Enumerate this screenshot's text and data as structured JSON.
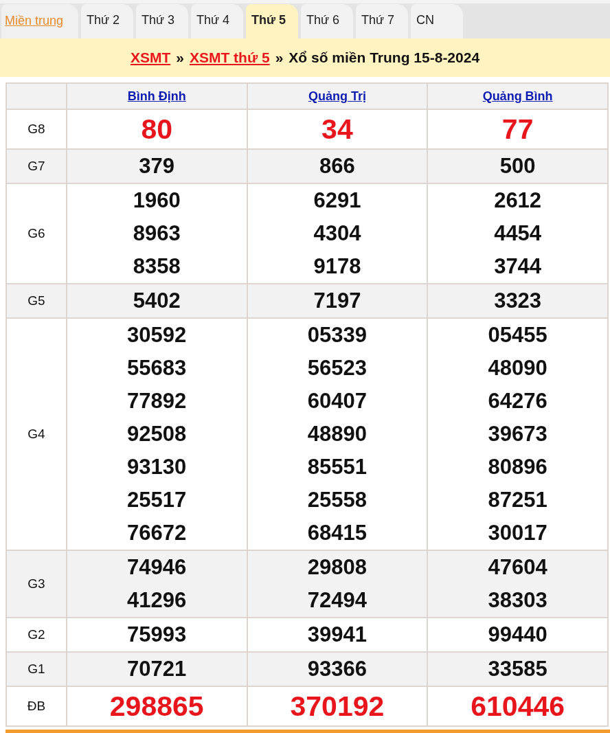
{
  "region_link": "Miền trung",
  "tabs": [
    {
      "label": "Thứ 2",
      "selected": false
    },
    {
      "label": "Thứ 3",
      "selected": false
    },
    {
      "label": "Thứ 4",
      "selected": false
    },
    {
      "label": "Thứ 5",
      "selected": true
    },
    {
      "label": "Thứ 6",
      "selected": false
    },
    {
      "label": "Thứ 7",
      "selected": false
    },
    {
      "label": "CN",
      "selected": false
    }
  ],
  "breadcrumb": {
    "links": [
      "XSMT",
      "XSMT thứ 5"
    ],
    "separator": "»",
    "title": "Xổ số miền Trung 15-8-2024"
  },
  "table": {
    "provinces": [
      "Bình Định",
      "Quảng Trị",
      "Quảng Bình"
    ],
    "prizes": [
      {
        "label": "G8",
        "kind": "highlight",
        "numbers": [
          [
            "80"
          ],
          [
            "34"
          ],
          [
            "77"
          ]
        ]
      },
      {
        "label": "G7",
        "kind": "normal",
        "numbers": [
          [
            "379"
          ],
          [
            "866"
          ],
          [
            "500"
          ]
        ]
      },
      {
        "label": "G6",
        "kind": "normal",
        "numbers": [
          [
            "1960",
            "8963",
            "8358"
          ],
          [
            "6291",
            "4304",
            "9178"
          ],
          [
            "2612",
            "4454",
            "3744"
          ]
        ]
      },
      {
        "label": "G5",
        "kind": "normal",
        "numbers": [
          [
            "5402"
          ],
          [
            "7197"
          ],
          [
            "3323"
          ]
        ]
      },
      {
        "label": "G4",
        "kind": "normal",
        "numbers": [
          [
            "30592",
            "55683",
            "77892",
            "92508",
            "93130",
            "25517",
            "76672"
          ],
          [
            "05339",
            "56523",
            "60407",
            "48890",
            "85551",
            "25558",
            "68415"
          ],
          [
            "05455",
            "48090",
            "64276",
            "39673",
            "80896",
            "87251",
            "30017"
          ]
        ]
      },
      {
        "label": "G3",
        "kind": "normal",
        "numbers": [
          [
            "74946",
            "41296"
          ],
          [
            "29808",
            "72494"
          ],
          [
            "47604",
            "38303"
          ]
        ]
      },
      {
        "label": "G2",
        "kind": "normal",
        "numbers": [
          [
            "75993"
          ],
          [
            "39941"
          ],
          [
            "99440"
          ]
        ]
      },
      {
        "label": "G1",
        "kind": "normal",
        "numbers": [
          [
            "70721"
          ],
          [
            "93366"
          ],
          [
            "33585"
          ]
        ]
      },
      {
        "label": "ĐB",
        "kind": "highlight",
        "numbers": [
          [
            "298865"
          ],
          [
            "370192"
          ],
          [
            "610446"
          ]
        ]
      }
    ]
  }
}
